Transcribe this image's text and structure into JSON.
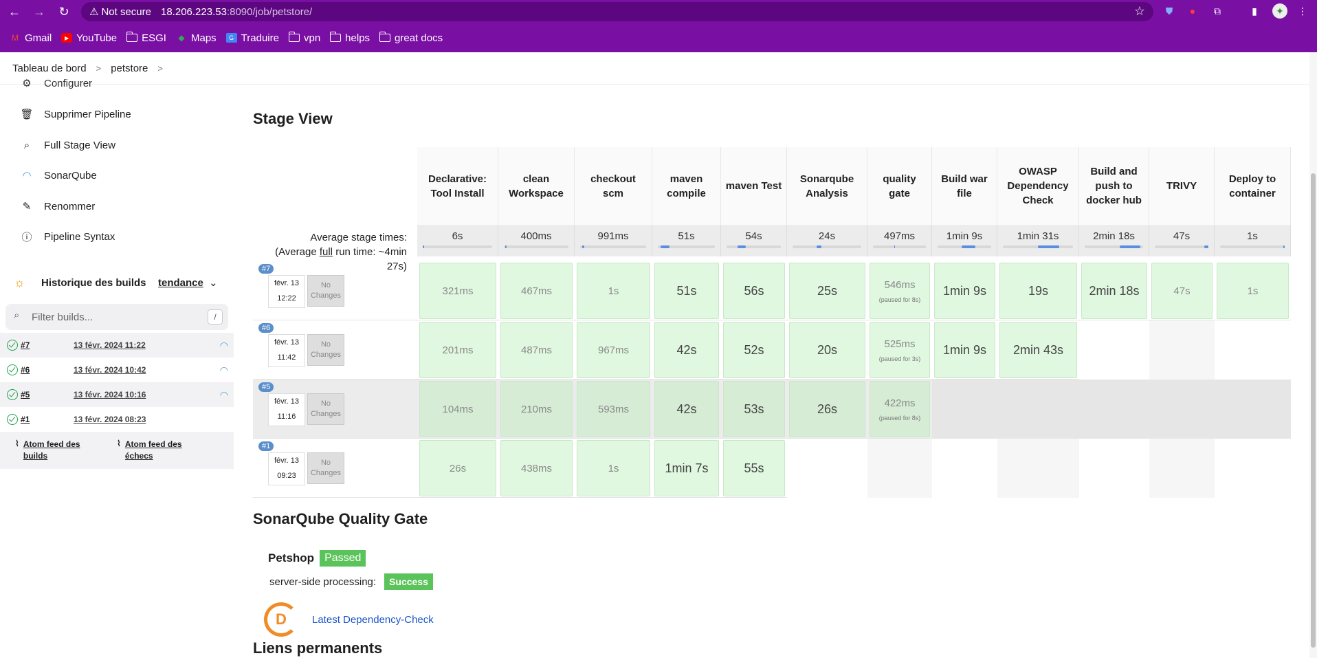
{
  "browser": {
    "security": "Not secure",
    "url_host": "18.206.223.53",
    "url_rest": ":8090/job/petstore/",
    "bookmarks": [
      "Gmail",
      "YouTube",
      "ESGI",
      "Maps",
      "Traduire",
      "vpn",
      "helps",
      "great docs"
    ]
  },
  "breadcrumb": [
    "Tableau de bord",
    "petstore"
  ],
  "sidebar": {
    "items": [
      "Configurer",
      "Supprimer Pipeline",
      "Full Stage View",
      "SonarQube",
      "Renommer",
      "Pipeline Syntax"
    ],
    "history_title": "Historique des builds",
    "trend": "tendance",
    "filter_placeholder": "Filter builds...",
    "filter_key": "/",
    "builds": [
      {
        "num": "#7",
        "date": "13 févr. 2024 11:22",
        "sonar": true
      },
      {
        "num": "#6",
        "date": "13 févr. 2024 10:42",
        "sonar": true
      },
      {
        "num": "#5",
        "date": "13 févr. 2024 10:16",
        "sonar": true
      },
      {
        "num": "#1",
        "date": "13 févr. 2024 08:23",
        "sonar": false
      }
    ],
    "feeds": [
      "Atom feed des builds",
      "Atom feed des échecs"
    ]
  },
  "main": {
    "stage_view_title": "Stage View",
    "avg_label_1": "Average stage times:",
    "avg_label_2a": "(Average ",
    "avg_label_full": "full",
    "avg_label_2b": " run time: ~4min",
    "avg_label_3": "27s)",
    "stages": [
      {
        "name": "Declarative: Tool Install",
        "avg": "6s",
        "bar": [
          0.0,
          0.0
        ]
      },
      {
        "name": "clean Workspace",
        "avg": "400ms",
        "bar": [
          0.02,
          0.02
        ]
      },
      {
        "name": "checkout scm",
        "avg": "991ms",
        "bar": [
          0.03,
          0.03
        ]
      },
      {
        "name": "maven compile",
        "avg": "51s",
        "bar": [
          0.05,
          0.15
        ]
      },
      {
        "name": "maven Test",
        "avg": "54s",
        "bar": [
          0.2,
          0.15
        ]
      },
      {
        "name": "Sonarqube Analysis",
        "avg": "24s",
        "bar": [
          0.35,
          0.07
        ]
      },
      {
        "name": "quality gate",
        "avg": "497ms",
        "bar": [
          0.4,
          0.02
        ]
      },
      {
        "name": "Build war file",
        "avg": "1min 9s",
        "bar": [
          0.45,
          0.25
        ]
      },
      {
        "name": "OWASP Dependency Check",
        "avg": "1min 31s",
        "bar": [
          0.5,
          0.3
        ]
      },
      {
        "name": "Build and push to docker hub",
        "avg": "2min 18s",
        "bar": [
          0.6,
          0.35
        ]
      },
      {
        "name": "TRIVY",
        "avg": "47s",
        "bar": [
          0.92,
          0.08
        ]
      },
      {
        "name": "Deploy to container",
        "avg": "1s",
        "bar": [
          0.98,
          0.02
        ]
      }
    ],
    "runs": [
      {
        "badge": "#7",
        "date1": "févr. 13",
        "date2": "12:22",
        "changes": "No Changes",
        "cells": [
          "321ms",
          "467ms",
          "1s",
          "51s",
          "56s",
          "25s",
          "546ms|(paused for 8s)",
          "1min 9s",
          "19s",
          "2min 18s",
          "47s",
          "1s"
        ]
      },
      {
        "badge": "#6",
        "date1": "févr. 13",
        "date2": "11:42",
        "changes": "No Changes",
        "cells": [
          "201ms",
          "487ms",
          "967ms",
          "42s",
          "52s",
          "20s",
          "525ms|(paused for 3s)",
          "1min 9s",
          "2min 43s",
          "",
          "",
          ""
        ]
      },
      {
        "badge": "#5",
        "date1": "févr. 13",
        "date2": "11:16",
        "changes": "No Changes",
        "cells": [
          "104ms",
          "210ms",
          "593ms",
          "42s",
          "53s",
          "26s",
          "422ms|(paused for 8s)",
          "",
          "",
          "",
          "",
          ""
        ]
      },
      {
        "badge": "#1",
        "date1": "févr. 13",
        "date2": "09:23",
        "changes": "No Changes",
        "cells": [
          "26s",
          "438ms",
          "1s",
          "1min 7s",
          "55s",
          "",
          "",
          "",
          "",
          "",
          "",
          ""
        ]
      }
    ],
    "sonar_title": "SonarQube Quality Gate",
    "project": "Petshop",
    "passed": "Passed",
    "processing_label": "server-side processing:",
    "success": "Success",
    "dependency_link": "Latest Dependency-Check",
    "permalinks_title": "Liens permanents"
  }
}
